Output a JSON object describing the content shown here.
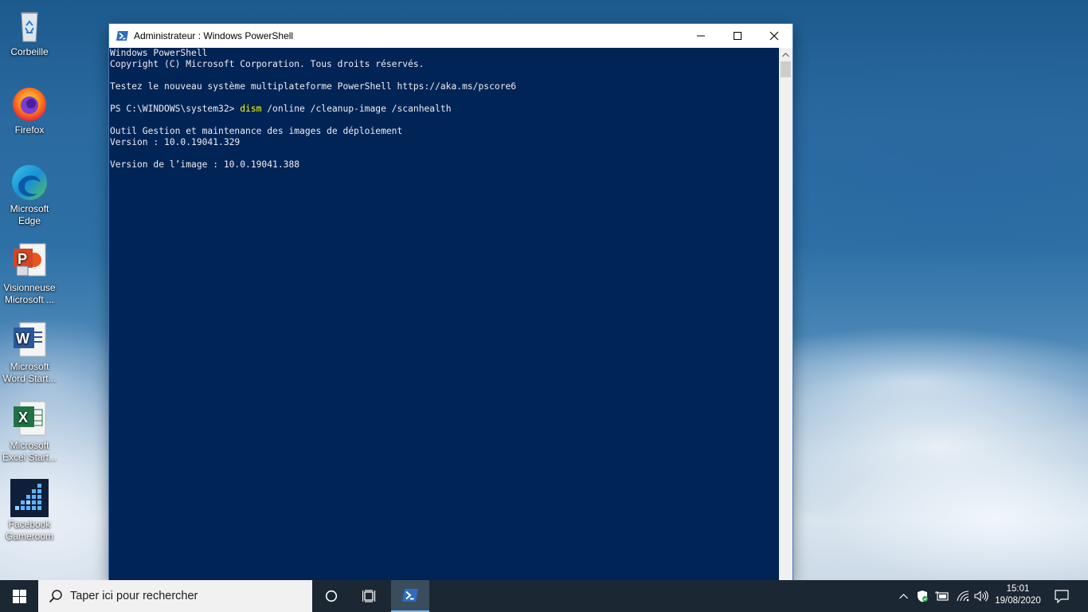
{
  "desktop": {
    "icons": [
      {
        "label": "Corbeille",
        "icon": "recycle-bin-icon"
      },
      {
        "label": "Firefox",
        "icon": "firefox-icon"
      },
      {
        "label": "Microsoft Edge",
        "icon": "edge-icon"
      },
      {
        "label": "Visionneuse Microsoft ...",
        "icon": "powerpoint-viewer-icon"
      },
      {
        "label": "Microsoft Word Start...",
        "icon": "word-icon"
      },
      {
        "label": "Microsoft Excel Start...",
        "icon": "excel-icon"
      },
      {
        "label": "Facebook Gameroom",
        "icon": "gameroom-icon"
      }
    ]
  },
  "window": {
    "title": "Administrateur : Windows PowerShell",
    "minimize_glyph": "—",
    "maximize_glyph": "☐",
    "close_glyph": "✕",
    "console_lines": [
      {
        "text": "Windows PowerShell"
      },
      {
        "text": "Copyright (C) Microsoft Corporation. Tous droits réservés."
      },
      {
        "text": ""
      },
      {
        "text": "Testez le nouveau système multiplateforme PowerShell https://aka.ms/pscore6"
      },
      {
        "text": ""
      },
      {
        "prompt": "PS C:\\WINDOWS\\system32> ",
        "command": "dism",
        "args": " /online /cleanup-image /scanhealth"
      },
      {
        "text": ""
      },
      {
        "text": "Outil Gestion et maintenance des images de déploiement"
      },
      {
        "text": "Version : 10.0.19041.329"
      },
      {
        "text": ""
      },
      {
        "text": "Version de l’image : 10.0.19041.388"
      }
    ],
    "colors": {
      "console_bg": "#012456",
      "console_fg": "#eeedf0",
      "command": "#ffff00"
    }
  },
  "taskbar": {
    "search_placeholder": "Taper ici pour rechercher",
    "clock_time": "15:01",
    "clock_date": "19/08/2020"
  }
}
